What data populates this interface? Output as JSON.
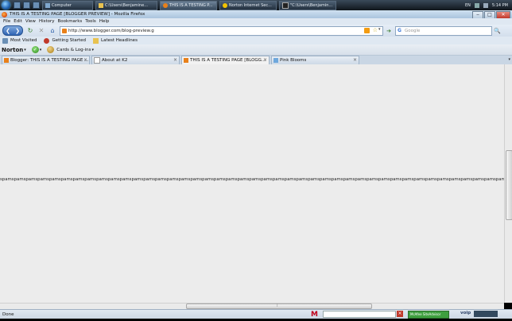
{
  "taskbar": {
    "tasks": [
      {
        "label": "Computer",
        "active": false
      },
      {
        "label": "C:\\Users\\Benjamine...",
        "active": false
      },
      {
        "label": "THIS IS A TESTING P...",
        "active": true
      },
      {
        "label": "Norton Internet Sec...",
        "active": false
      },
      {
        "label": "\"C:\\Users\\Benjamin...",
        "active": false
      }
    ],
    "language": "EN",
    "time": "5:14 PM"
  },
  "window": {
    "title": "THIS IS A TESTING PAGE [BLOGGER PREVIEW] - Mozilla Firefox",
    "minimize_glyph": "‒",
    "maximize_glyph": "□",
    "close_glyph": "✕"
  },
  "menu": {
    "items": [
      "File",
      "Edit",
      "View",
      "History",
      "Bookmarks",
      "Tools",
      "Help"
    ]
  },
  "navbar": {
    "url": "http://www.blogger.com/blog-preview.g",
    "search_placeholder": "Google",
    "back_glyph": "❮",
    "forward_glyph": "❯",
    "reload_glyph": "↻",
    "stop_glyph": "✕",
    "home_glyph": "⌂",
    "go_glyph": "➔",
    "search_go_glyph": "🔍"
  },
  "bookmarks": {
    "items": [
      "Most Visited",
      "Getting Started",
      "Latest Headlines"
    ]
  },
  "norton": {
    "logo": "Norton",
    "cards_label": "Cards & Log-ins"
  },
  "tabs": [
    {
      "label": "Blogger: THIS IS A TESTING PAGE - ...",
      "selected": false
    },
    {
      "label": "About at K2",
      "selected": false
    },
    {
      "label": "THIS IS A TESTING PAGE [BLOGG...",
      "selected": true
    },
    {
      "label": "Pink Blooms",
      "selected": false
    }
  ],
  "content": {
    "spam_text": "spamspamspamspamspamspamspamspamspamspamspamspamspamspamspamspamspamspamspamspamspamspamspamspamspamspamspamspamspamspamspamspamspamspamspamspamspamspamspamspamspamspamspamspamspamspamspamspamspamspamspamspamspamspamspamspamspamspamspamspamspamspamspamspamspam"
  },
  "status": {
    "text": "Done",
    "mcafee_letter": "M",
    "siteadvisor_label": "McAfee SiteAdvisor",
    "voip_label": "voip"
  },
  "colors": {
    "accent": "#2f64b4",
    "content_bg": "#ececec"
  }
}
